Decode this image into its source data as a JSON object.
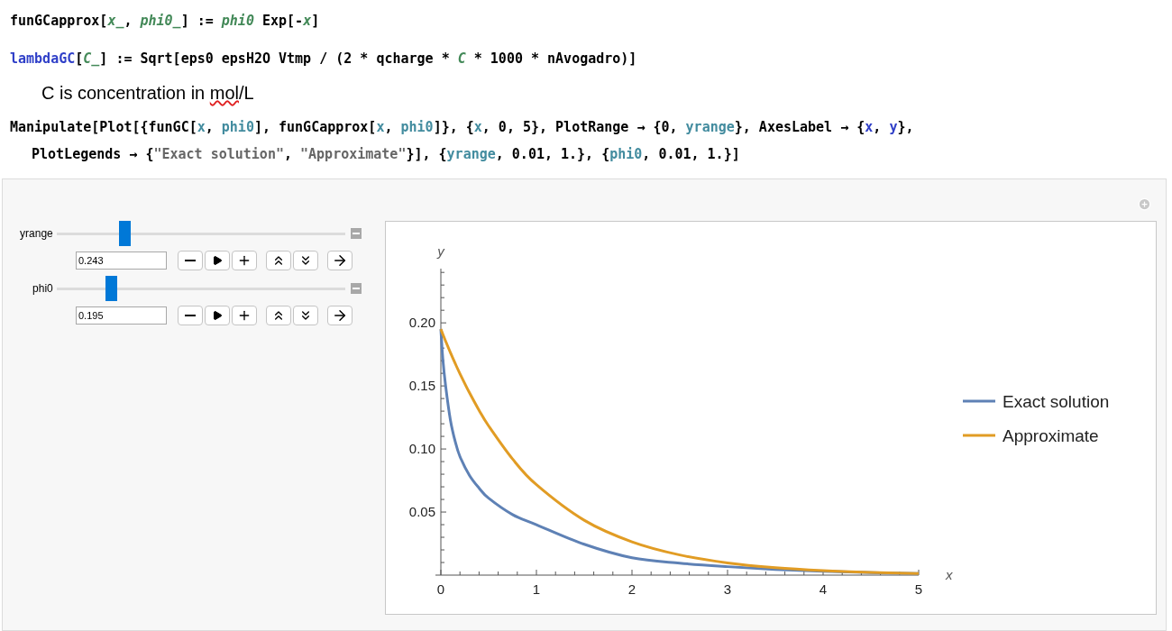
{
  "cells": [
    {
      "kind": "input",
      "lines": [
        [
          {
            "text": "funGCapprox[",
            "kind": "plain"
          },
          {
            "text": "x_",
            "kind": "pattern"
          },
          {
            "text": ", ",
            "kind": "plain"
          },
          {
            "text": "phi0_",
            "kind": "pattern"
          },
          {
            "text": "] := ",
            "kind": "plain"
          },
          {
            "text": "phi0",
            "kind": "pattern"
          },
          {
            "text": " Exp[-",
            "kind": "plain"
          },
          {
            "text": "x",
            "kind": "pattern"
          },
          {
            "text": "]",
            "kind": "plain"
          }
        ]
      ]
    },
    {
      "kind": "input",
      "lines": [
        [
          {
            "text": "lambdaGC",
            "kind": "global"
          },
          {
            "text": "[",
            "kind": "plain"
          },
          {
            "text": "C_",
            "kind": "pattern"
          },
          {
            "text": "] := Sqrt[eps0 epsH2O Vtmp / (2 * qcharge * ",
            "kind": "plain"
          },
          {
            "text": "C",
            "kind": "pattern"
          },
          {
            "text": " * 1000 * nAvogadro)]",
            "kind": "plain"
          }
        ]
      ]
    },
    {
      "kind": "text",
      "lines": [
        [
          {
            "text": "C is concentration in ",
            "kind": "plain"
          },
          {
            "text": "mol",
            "kind": "misspelled"
          },
          {
            "text": "/L",
            "kind": "plain"
          }
        ]
      ]
    },
    {
      "kind": "input",
      "lines": [
        [
          {
            "text": "Manipulate[Plot[{funGC[",
            "kind": "plain"
          },
          {
            "text": "x",
            "kind": "local"
          },
          {
            "text": ", ",
            "kind": "plain"
          },
          {
            "text": "phi0",
            "kind": "local"
          },
          {
            "text": "], funGCapprox[",
            "kind": "plain"
          },
          {
            "text": "x",
            "kind": "local"
          },
          {
            "text": ", ",
            "kind": "plain"
          },
          {
            "text": "phi0",
            "kind": "local"
          },
          {
            "text": "]}, {",
            "kind": "plain"
          },
          {
            "text": "x",
            "kind": "local"
          },
          {
            "text": ", 0, 5}, PlotRange → {0, ",
            "kind": "plain"
          },
          {
            "text": "yrange",
            "kind": "local"
          },
          {
            "text": "}, AxesLabel → {",
            "kind": "plain"
          },
          {
            "text": "x",
            "kind": "global"
          },
          {
            "text": ", ",
            "kind": "plain"
          },
          {
            "text": "y",
            "kind": "global"
          },
          {
            "text": "},",
            "kind": "plain"
          }
        ],
        [
          {
            "text": "PlotLegends → {",
            "kind": "plain"
          },
          {
            "text": "\"Exact solution\"",
            "kind": "string"
          },
          {
            "text": ", ",
            "kind": "plain"
          },
          {
            "text": "\"Approximate\"",
            "kind": "string"
          },
          {
            "text": "}], {",
            "kind": "plain"
          },
          {
            "text": "yrange",
            "kind": "local"
          },
          {
            "text": ", 0.01, 1.}, {",
            "kind": "plain"
          },
          {
            "text": "phi0",
            "kind": "local"
          },
          {
            "text": ", 0.01, 1.}]",
            "kind": "plain"
          }
        ]
      ]
    }
  ],
  "manipulate": {
    "controls": [
      {
        "label": "yrange",
        "level": 0.235,
        "value": "0.243"
      },
      {
        "label": "phi0",
        "level": 0.187,
        "value": "0.195"
      }
    ],
    "plot": {
      "x_axis_label": "x",
      "y_axis_label": "y",
      "chart_data": {
        "type": "line",
        "legend": "right",
        "x": [
          0,
          0.02,
          0.05,
          0.1,
          0.15,
          0.2,
          0.3,
          0.4,
          0.5,
          0.75,
          1,
          1.5,
          2,
          2.5,
          3,
          3.5,
          4,
          4.5,
          5
        ],
        "xlim": [
          0,
          5
        ],
        "ylim": [
          0,
          0.243
        ],
        "xticks": [
          {
            "value": 0,
            "label": "0"
          },
          {
            "value": 1,
            "label": "1"
          },
          {
            "value": 2,
            "label": "2"
          },
          {
            "value": 3,
            "label": "3"
          },
          {
            "value": 4,
            "label": "4"
          },
          {
            "value": 5,
            "label": "5"
          }
        ],
        "yticks": [
          {
            "value": 0.05,
            "label": "0.05"
          },
          {
            "value": 0.1,
            "label": "0.10"
          },
          {
            "value": 0.15,
            "label": "0.15"
          },
          {
            "value": 0.2,
            "label": "0.20"
          }
        ],
        "series": [
          {
            "name": "Exact solution",
            "color": "#5e81b5",
            "values": [
              0.195,
              0.172,
              0.15,
              0.123,
              0.106,
              0.094,
              0.079,
              0.069,
              0.061,
              0.048,
              0.04,
              0.0245,
              0.0138,
              0.0095,
              0.0067,
              0.0045,
              0.003,
              0.002,
              0.0012
            ]
          },
          {
            "name": "Approximate",
            "color": "#e19c24",
            "values": [
              0.195,
              0.1911,
              0.1855,
              0.1764,
              0.1678,
              0.1597,
              0.1445,
              0.1307,
              0.1183,
              0.0921,
              0.0717,
              0.0435,
              0.0264,
              0.016,
              0.0097,
              0.0059,
              0.0036,
              0.0022,
              0.0013
            ]
          }
        ]
      }
    }
  }
}
